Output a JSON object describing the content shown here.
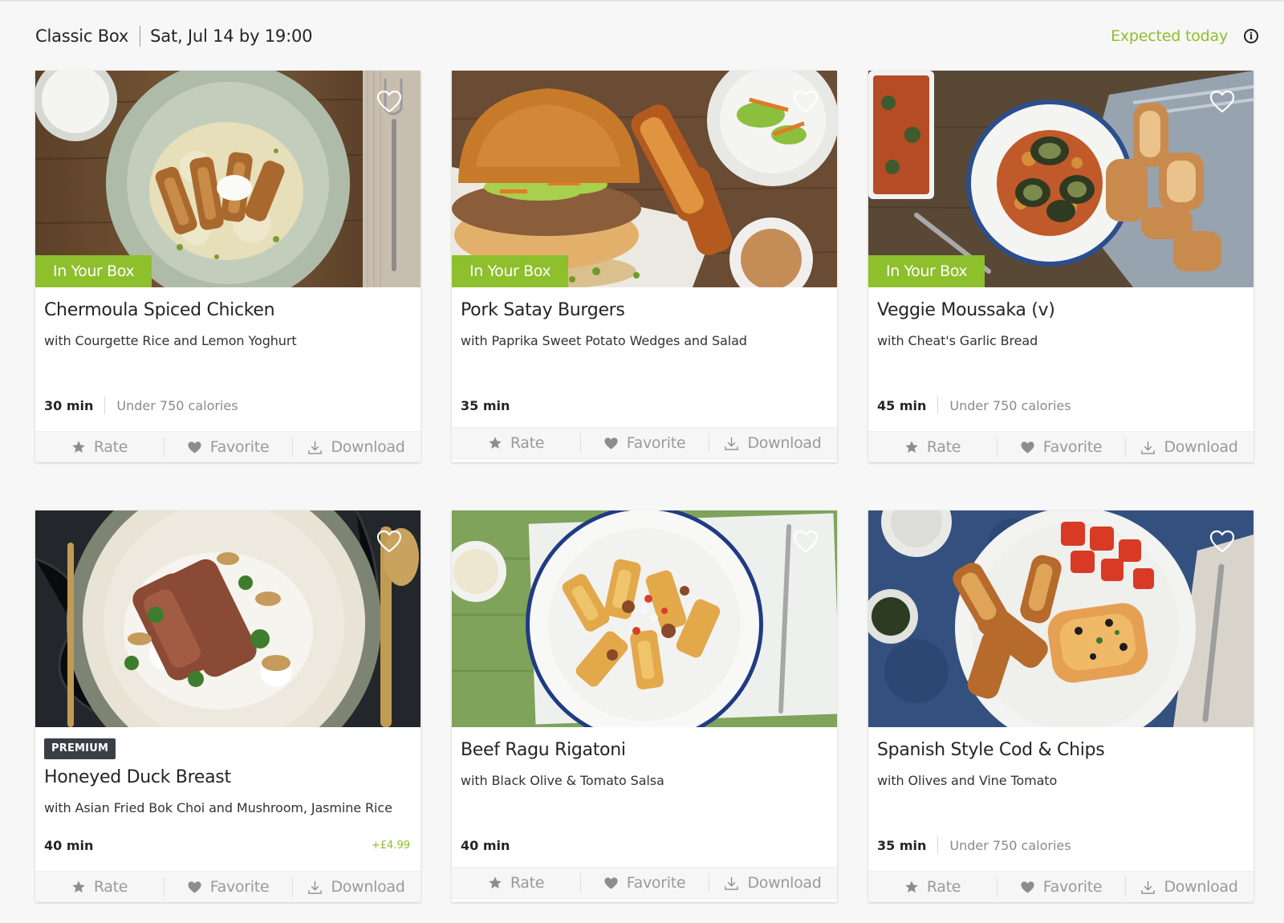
{
  "header": {
    "box_name": "Classic Box",
    "delivery": "Sat, Jul 14 by 19:00",
    "status": "Expected today",
    "status_color": "#8ebf2c",
    "info_icon": "info-icon"
  },
  "actions": {
    "rate": "Rate",
    "favorite": "Favorite",
    "download": "Download"
  },
  "labels": {
    "in_box": "In Your Box",
    "premium": "PREMIUM"
  },
  "cards": [
    {
      "title": "Chermoula Spiced Chicken",
      "subtitle": "with Courgette Rice and Lemon Yoghurt",
      "time": "30 min",
      "calories": "Under 750 calories",
      "in_box": true,
      "premium": false,
      "price": ""
    },
    {
      "title": "Pork Satay Burgers",
      "subtitle": "with Paprika Sweet Potato Wedges and Salad",
      "time": "35 min",
      "calories": "",
      "in_box": true,
      "premium": false,
      "price": ""
    },
    {
      "title": "Veggie Moussaka (v)",
      "subtitle": "with Cheat's Garlic Bread",
      "time": "45 min",
      "calories": "Under 750 calories",
      "in_box": true,
      "premium": false,
      "price": ""
    },
    {
      "title": "Honeyed Duck Breast",
      "subtitle": "with Asian Fried Bok Choi and Mushroom, Jasmine Rice",
      "time": "40 min",
      "calories": "",
      "in_box": false,
      "premium": true,
      "price": "+£4.99"
    },
    {
      "title": "Beef Ragu Rigatoni",
      "subtitle": "with Black Olive & Tomato Salsa",
      "time": "40 min",
      "calories": "",
      "in_box": false,
      "premium": false,
      "price": ""
    },
    {
      "title": "Spanish Style Cod & Chips",
      "subtitle": "with Olives and Vine Tomato",
      "time": "35 min",
      "calories": "Under 750 calories",
      "in_box": false,
      "premium": false,
      "price": ""
    }
  ]
}
